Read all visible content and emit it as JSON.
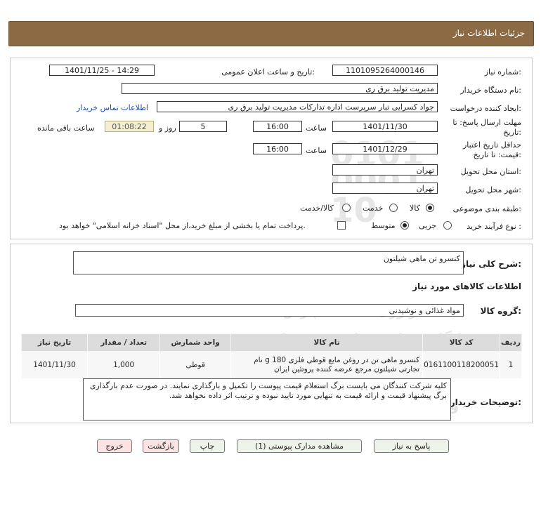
{
  "header": {
    "title": "جزئیات اطلاعات نیاز"
  },
  "form": {
    "need_number_label": "شماره نیاز:",
    "need_number": "1101095264000146",
    "announce_label": "تاریخ و ساعت اعلان عمومی:",
    "announce_value": "1401/11/25 - 14:29",
    "buyer_label": "نام دستگاه خریدار:",
    "buyer_value": "مدیریت تولید برق ری",
    "creator_label": "ایجاد کننده درخواست:",
    "creator_value": "جواد کسرایی تبار سرپرست اداره تدارکات مدیریت تولید برق ری",
    "contact_link": "اطلاعات تماس خریدار",
    "deadline_label_1": "مهلت ارسال پاسخ: تا",
    "deadline_label_2": "تاریخ:",
    "deadline_date": "1401/11/30",
    "time_label": "ساعت",
    "deadline_time": "16:00",
    "days_value": "5",
    "days_label": "روز و",
    "remaining_time": "01:08:22",
    "remaining_label": "ساعت باقی مانده",
    "validity_label_1": "حداقل تاریخ اعتبار",
    "validity_label_2": "قیمت: تا تاریخ:",
    "validity_date": "1401/12/29",
    "validity_time": "16:00",
    "province_label": "استان محل تحویل:",
    "province_value": "تهران",
    "city_label": "شهر محل تحویل:",
    "city_value": "تهران",
    "category_label": "طبقه بندی موضوعی:",
    "category_options": [
      "کالا",
      "خدمت",
      "کالا/خدمت"
    ],
    "process_label": "نوع فرآیند خرید :",
    "process_options": [
      "جزیی",
      "متوسط"
    ],
    "payment_note": "پرداخت تمام یا بخشی از مبلغ خرید،از محل \"اسناد خزانه اسلامی\" خواهد بود."
  },
  "summary": {
    "label": "شرح کلی نیاز:",
    "value": "کنسرو تن ماهی شیلتون",
    "goods_info_title": "اطلاعات کالاهای مورد نیاز",
    "group_label": "گروه کالا:",
    "group_value": "مواد غذائی و نوشیدنی"
  },
  "table": {
    "headers": [
      "ردیف",
      "کد کالا",
      "نام کالا",
      "واحد شمارش",
      "تعداد / مقدار",
      "تاریخ نیاز"
    ],
    "rows": [
      [
        "1",
        "0161100118200051",
        "کنسرو ماهی تن در روغن مایع قوطی فلزی 180 g نام تجارتی شیلتون مرجع عرضه کننده پروتئین ایران",
        "قوطی",
        "1,000",
        "1401/11/30"
      ]
    ]
  },
  "notes": {
    "label": "توضیحات خریدار:",
    "value": "کلیه شرکت کنندگان می بایست برگ استعلام قیمت پیوست را تکمیل و بارگذاری نمایند. در صورت عدم بارگذاری برگ پیشنهاد قیمت و ارائه قیمت به تنهایی مورد تایید نبوده و ترتیب اثر داده نخواهد شد."
  },
  "buttons": {
    "reply": "پاسخ به نیاز",
    "attachments": "مشاهده مدارک پیوستی (1)",
    "print": "چاپ",
    "back": "بازگشت",
    "exit": "خروج"
  },
  "watermark": {
    "line1": "ParsNamadData",
    "line2": "پایگاه رسانی مناقصه و مزایده",
    "line3": "فرآوری اطلاعات پارس نماد داده",
    "phone": "۰۲۱-۸۸۳۴۹۶۷۰ و ۸۸۳۴۹۶۷۰"
  },
  "colors": {
    "header_bg": "#8c6a43",
    "link": "#1a4aa3",
    "timer_bg": "#f3efd0"
  }
}
